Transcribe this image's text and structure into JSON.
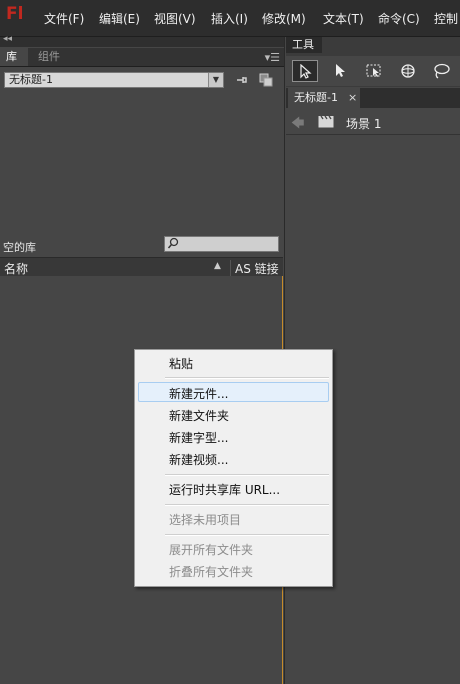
{
  "app": {
    "logo": "Fl"
  },
  "menubar": {
    "items": [
      "文件(F)",
      "编辑(E)",
      "视图(V)",
      "插入(I)",
      "修改(M)",
      "文本(T)",
      "命令(C)",
      "控制"
    ]
  },
  "library": {
    "tabs": [
      "库",
      "组件"
    ],
    "document_selected": "无标题-1",
    "status": "空的库",
    "search_placeholder": "",
    "columns": {
      "name": "名称",
      "as_linkage": "AS 链接"
    }
  },
  "tools": {
    "tab_label": "工具",
    "items": [
      "selection-tool",
      "subselection-tool",
      "free-transform-tool",
      "3d-rotation-tool",
      "lasso-tool"
    ]
  },
  "document": {
    "tab_label": "无标题-1",
    "close_glyph": "×",
    "scene_label": "场景 1"
  },
  "context_menu": {
    "items": [
      {
        "label": "粘贴",
        "enabled": true
      },
      {
        "label": "新建元件...",
        "enabled": true,
        "highlighted": true
      },
      {
        "label": "新建文件夹",
        "enabled": true
      },
      {
        "label": "新建字型...",
        "enabled": true
      },
      {
        "label": "新建视频...",
        "enabled": true
      },
      {
        "label": "运行时共享库 URL...",
        "enabled": true
      },
      {
        "label": "选择未用项目",
        "enabled": false
      },
      {
        "label": "展开所有文件夹",
        "enabled": false
      },
      {
        "label": "折叠所有文件夹",
        "enabled": false
      }
    ]
  },
  "colors": {
    "logo": "#c1281f",
    "panel_bg": "#464646",
    "menubar_bg": "#2d2d2d",
    "menu_bg": "#f0f0f0",
    "menu_highlight": "#e5f0fb",
    "active_border": "#c58b2a"
  }
}
